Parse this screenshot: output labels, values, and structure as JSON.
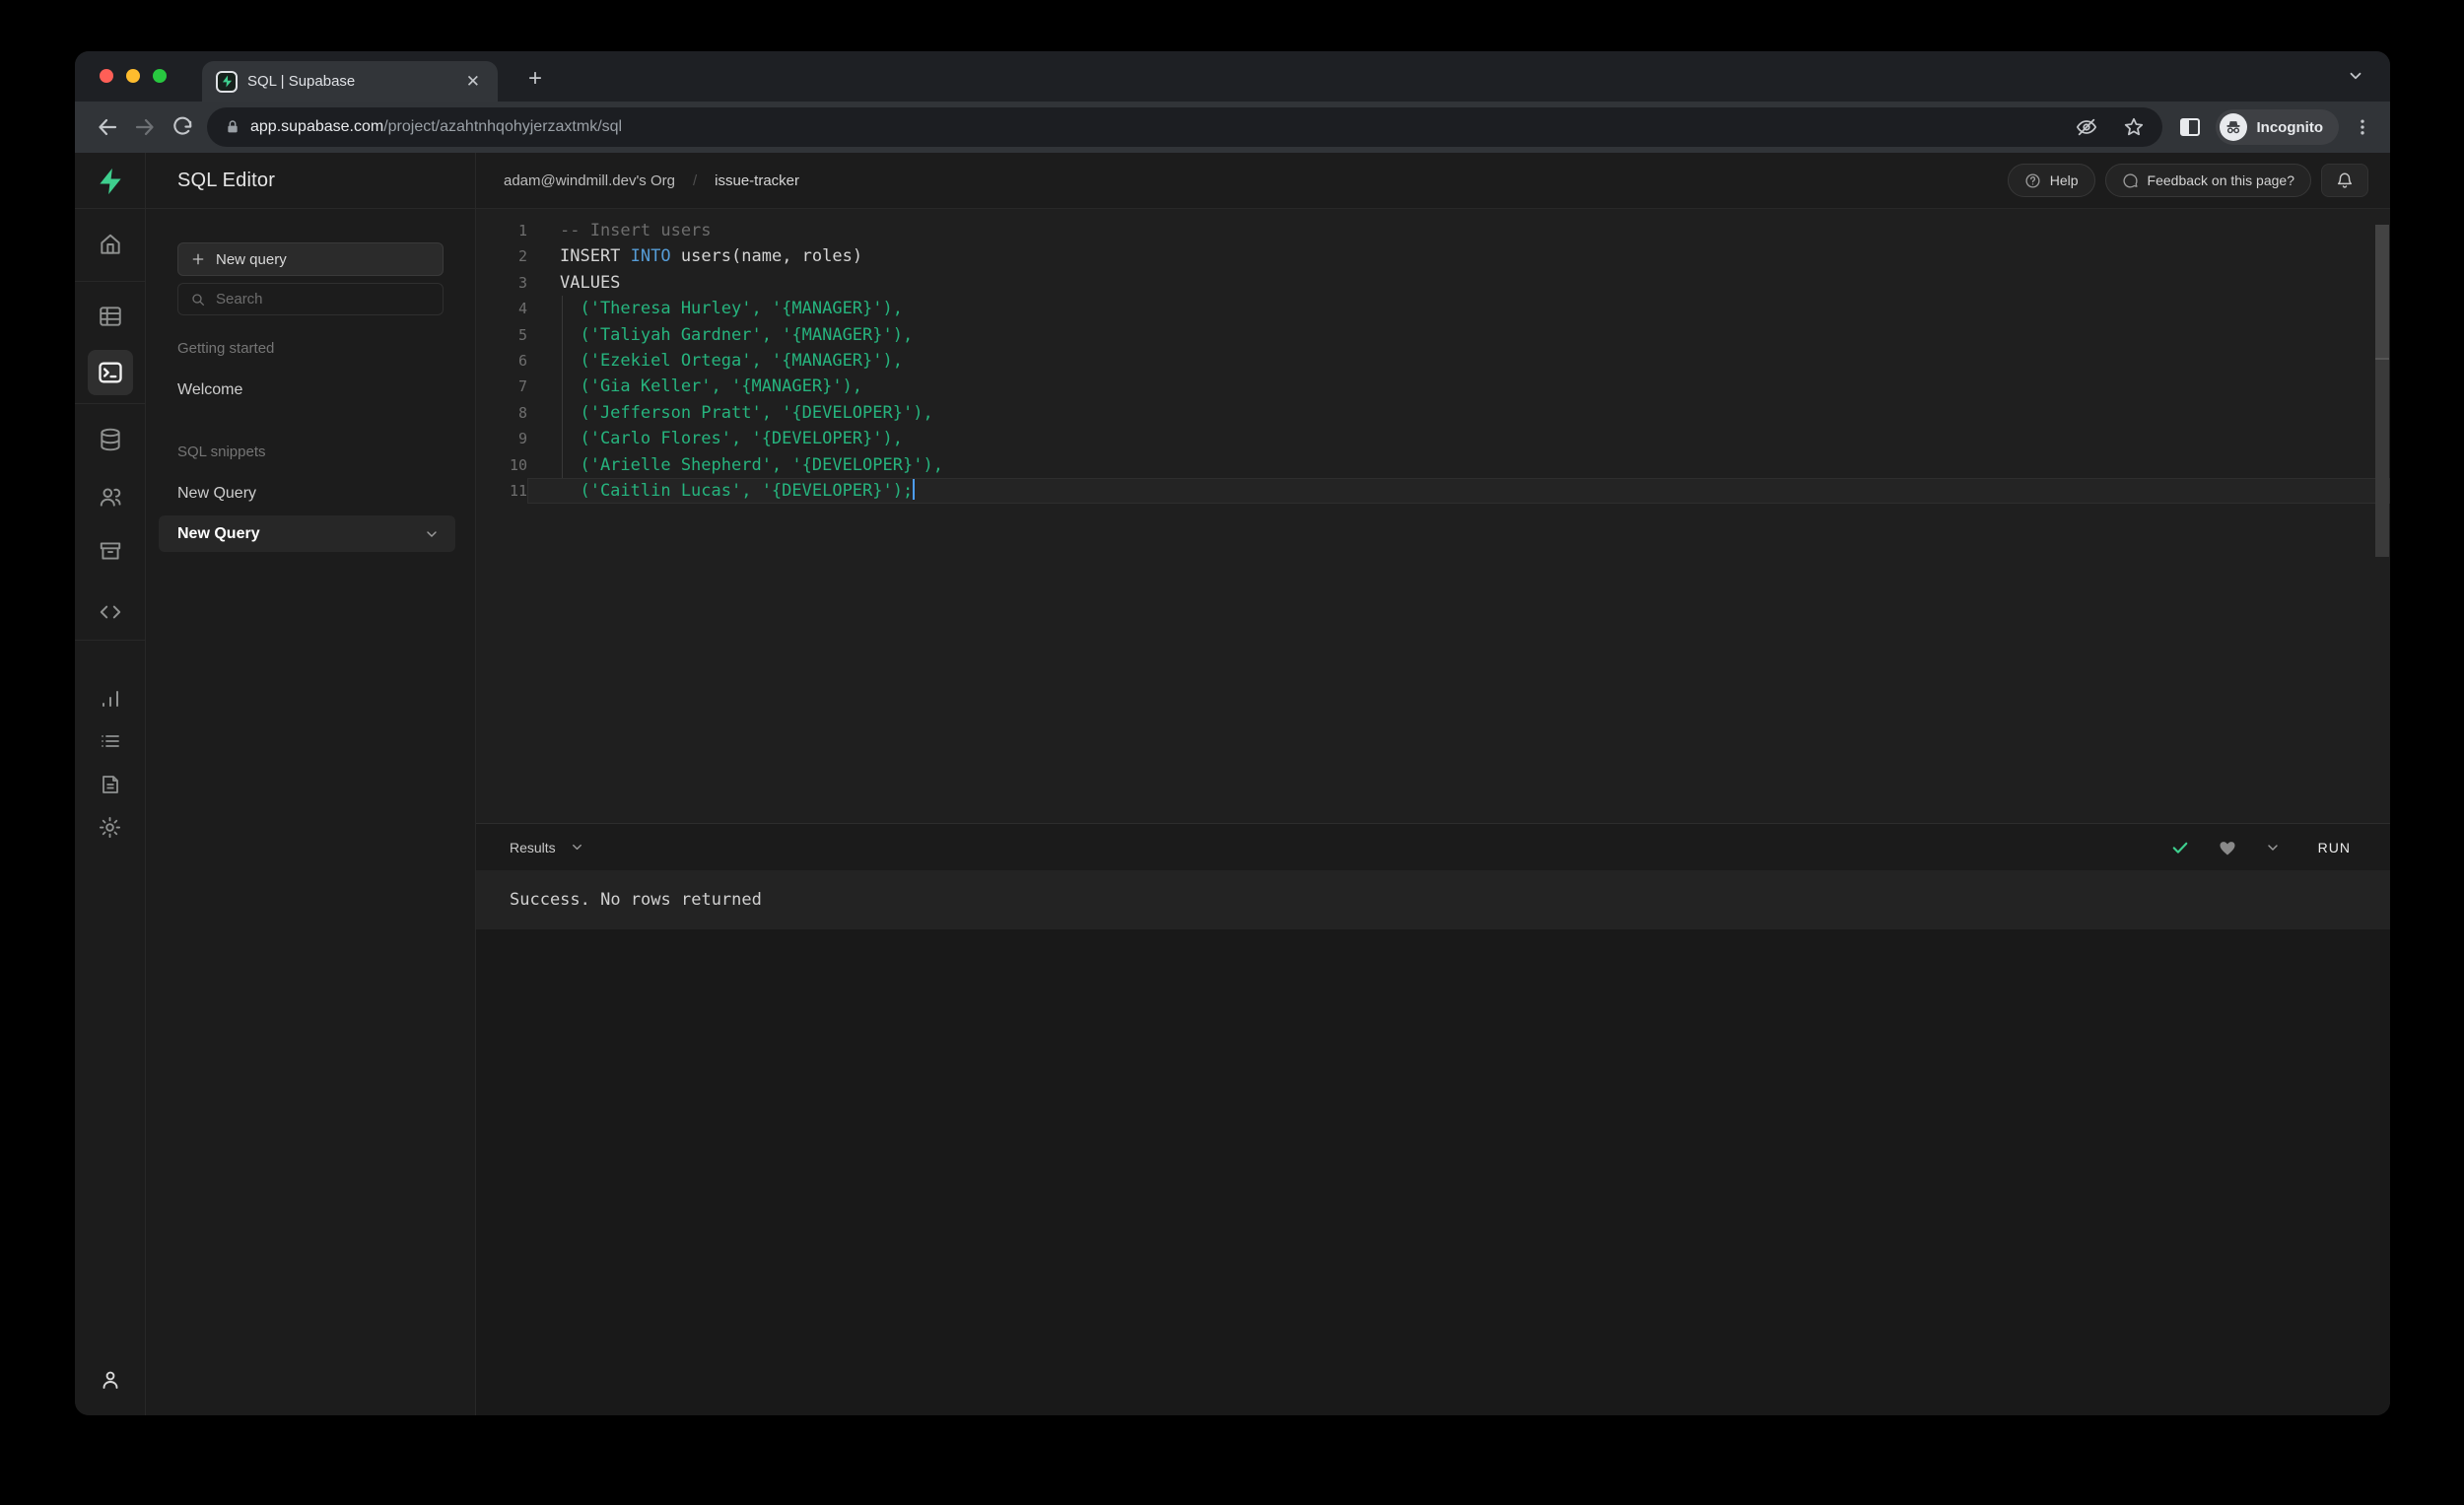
{
  "browser": {
    "tab_title": "SQL | Supabase",
    "url_domain": "app.supabase.com",
    "url_path": "/project/azahtnhqohyjerzaxtmk/sql",
    "incognito_label": "Incognito",
    "icons": [
      "supabase-favicon",
      "tab-close",
      "new-tab-plus",
      "tab-search-chevron",
      "back-arrow",
      "forward-arrow",
      "reload",
      "lock",
      "eye-off",
      "star",
      "side-panel",
      "incognito-spy",
      "three-dot-menu"
    ]
  },
  "rail": {
    "items": [
      "supabase-logo",
      "home",
      "table-editor",
      "sql-editor",
      "database",
      "auth-users",
      "storage",
      "edge-functions",
      "reports",
      "logs",
      "docs",
      "settings",
      "account"
    ],
    "active_item": "sql-editor",
    "accent_color": "#3ecf8e"
  },
  "sidebar": {
    "title": "SQL Editor",
    "new_query_button": "New query",
    "search_placeholder": "Search",
    "sections": [
      {
        "label": "Getting started",
        "items": [
          "Welcome"
        ]
      },
      {
        "label": "SQL snippets",
        "items": [
          "New Query"
        ]
      }
    ],
    "selected_item": "New Query"
  },
  "header": {
    "breadcrumb_org": "adam@windmill.dev's Org",
    "breadcrumb_sep": "/",
    "breadcrumb_project": "issue-tracker",
    "help_button": "Help",
    "feedback_button": "Feedback on this page?"
  },
  "editor": {
    "cursor_line": 11,
    "colors": {
      "comment": "#6d6d6d",
      "keyword": "#569cd6",
      "plain": "#d4d4d4",
      "string": "#26b47e"
    },
    "lines": [
      {
        "n": 1,
        "tokens": [
          [
            "c",
            "-- Insert users"
          ]
        ]
      },
      {
        "n": 2,
        "tokens": [
          [
            "p",
            "INSERT "
          ],
          [
            "k",
            "INTO"
          ],
          [
            "p",
            " users(name, roles)"
          ]
        ]
      },
      {
        "n": 3,
        "tokens": [
          [
            "p",
            "VALUES"
          ]
        ]
      },
      {
        "n": 4,
        "tokens": [
          [
            "s",
            "  ('Theresa Hurley', '{MANAGER}'),"
          ]
        ]
      },
      {
        "n": 5,
        "tokens": [
          [
            "s",
            "  ('Taliyah Gardner', '{MANAGER}'),"
          ]
        ]
      },
      {
        "n": 6,
        "tokens": [
          [
            "s",
            "  ('Ezekiel Ortega', '{MANAGER}'),"
          ]
        ]
      },
      {
        "n": 7,
        "tokens": [
          [
            "s",
            "  ('Gia Keller', '{MANAGER}'),"
          ]
        ]
      },
      {
        "n": 8,
        "tokens": [
          [
            "s",
            "  ('Jefferson Pratt', '{DEVELOPER}'),"
          ]
        ]
      },
      {
        "n": 9,
        "tokens": [
          [
            "s",
            "  ('Carlo Flores', '{DEVELOPER}'),"
          ]
        ]
      },
      {
        "n": 10,
        "tokens": [
          [
            "s",
            "  ('Arielle Shepherd', '{DEVELOPER}'),"
          ]
        ]
      },
      {
        "n": 11,
        "tokens": [
          [
            "s",
            "  ('Caitlin Lucas', '{DEVELOPER}');"
          ]
        ]
      }
    ]
  },
  "results": {
    "dropdown_label": "Results",
    "run_button": "RUN",
    "status": "Success. No rows returned",
    "check_color": "#3ecf8e"
  }
}
